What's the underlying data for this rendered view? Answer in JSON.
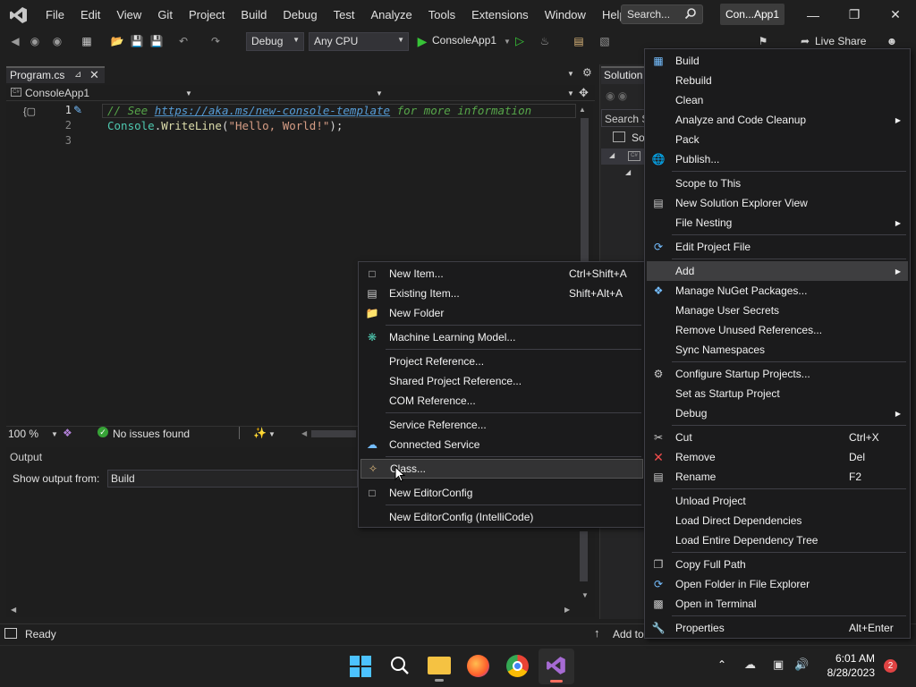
{
  "menubar": {
    "items": [
      "File",
      "Edit",
      "View",
      "Git",
      "Project",
      "Build",
      "Debug",
      "Test",
      "Analyze",
      "Tools",
      "Extensions",
      "Window",
      "Help"
    ],
    "search_label": "Search...",
    "title_badge": "Con...App1"
  },
  "toolbar": {
    "config": "Debug",
    "platform": "Any CPU",
    "run_target": "ConsoleApp1",
    "live_share": "Live Share"
  },
  "editor": {
    "tab_name": "Program.cs",
    "nav_project": "ConsoleApp1",
    "lines": [
      {
        "num": "1",
        "comment_prefix": "// See ",
        "link": "https://aka.ms/new-console-template",
        "comment_suffix": " for more information"
      },
      {
        "num": "2",
        "obj": "Console",
        "dot": ".",
        "method": "WriteLine",
        "open": "(",
        "str": "\"Hello, World!\"",
        "close": ");"
      },
      {
        "num": "3"
      }
    ],
    "zoom": "100 %",
    "issues": "No issues found"
  },
  "output": {
    "title": "Output",
    "show_from_label": "Show output from:",
    "source": "Build"
  },
  "solution_explorer": {
    "title": "Solution",
    "search": "Search S",
    "root": "So"
  },
  "status": {
    "ready": "Ready",
    "add_to": "Add to"
  },
  "add_menu": {
    "items": [
      {
        "label": "New Item...",
        "shortcut": "Ctrl+Shift+A",
        "icon": "new-item-icon"
      },
      {
        "label": "Existing Item...",
        "shortcut": "Shift+Alt+A",
        "icon": "existing-item-icon"
      },
      {
        "label": "New Folder",
        "icon": "folder-icon"
      },
      {
        "label": "Machine Learning Model...",
        "icon": "ml-model-icon"
      },
      {
        "label": "Project Reference..."
      },
      {
        "label": "Shared Project Reference..."
      },
      {
        "label": "COM Reference..."
      },
      {
        "label": "Service Reference..."
      },
      {
        "label": "Connected Service",
        "icon": "connected-service-icon"
      },
      {
        "label": "Class...",
        "icon": "class-icon"
      },
      {
        "label": "New EditorConfig",
        "icon": "file-icon"
      },
      {
        "label": "New EditorConfig (IntelliCode)"
      }
    ]
  },
  "project_menu": {
    "items": [
      {
        "label": "Build",
        "icon": "build-icon"
      },
      {
        "label": "Rebuild"
      },
      {
        "label": "Clean"
      },
      {
        "label": "Analyze and Code Cleanup",
        "submenu": true
      },
      {
        "label": "Pack"
      },
      {
        "label": "Publish...",
        "icon": "globe-icon"
      },
      {
        "label": "Scope to This"
      },
      {
        "label": "New Solution Explorer View",
        "icon": "window-icon"
      },
      {
        "label": "File Nesting",
        "submenu": true
      },
      {
        "label": "Edit Project File",
        "icon": "refresh-icon"
      },
      {
        "label": "Add",
        "submenu": true
      },
      {
        "label": "Manage NuGet Packages...",
        "icon": "nuget-icon"
      },
      {
        "label": "Manage User Secrets"
      },
      {
        "label": "Remove Unused References..."
      },
      {
        "label": "Sync Namespaces"
      },
      {
        "label": "Configure Startup Projects...",
        "icon": "gear-icon"
      },
      {
        "label": "Set as Startup Project"
      },
      {
        "label": "Debug",
        "submenu": true
      },
      {
        "label": "Cut",
        "shortcut": "Ctrl+X",
        "icon": "scissors-icon"
      },
      {
        "label": "Remove",
        "shortcut": "Del",
        "icon": "close-icon"
      },
      {
        "label": "Rename",
        "shortcut": "F2",
        "icon": "rename-icon"
      },
      {
        "label": "Unload Project"
      },
      {
        "label": "Load Direct Dependencies"
      },
      {
        "label": "Load Entire Dependency Tree"
      },
      {
        "label": "Copy Full Path",
        "icon": "copy-icon"
      },
      {
        "label": "Open Folder in File Explorer",
        "icon": "refresh-icon"
      },
      {
        "label": "Open in Terminal",
        "icon": "terminal-icon"
      },
      {
        "label": "Properties",
        "shortcut": "Alt+Enter",
        "icon": "wrench-icon"
      }
    ]
  },
  "taskbar": {
    "time": "6:01 AM",
    "date": "8/28/2023",
    "notification_count": "2"
  },
  "colors": {
    "accent": "#68217a",
    "comment": "#57a64a",
    "link": "#569cd6",
    "string": "#d69d85",
    "type": "#4ec9b0",
    "method": "#dcdcaa",
    "menu_bg": "#1b1b1c",
    "highlight": "#3e3e40"
  }
}
